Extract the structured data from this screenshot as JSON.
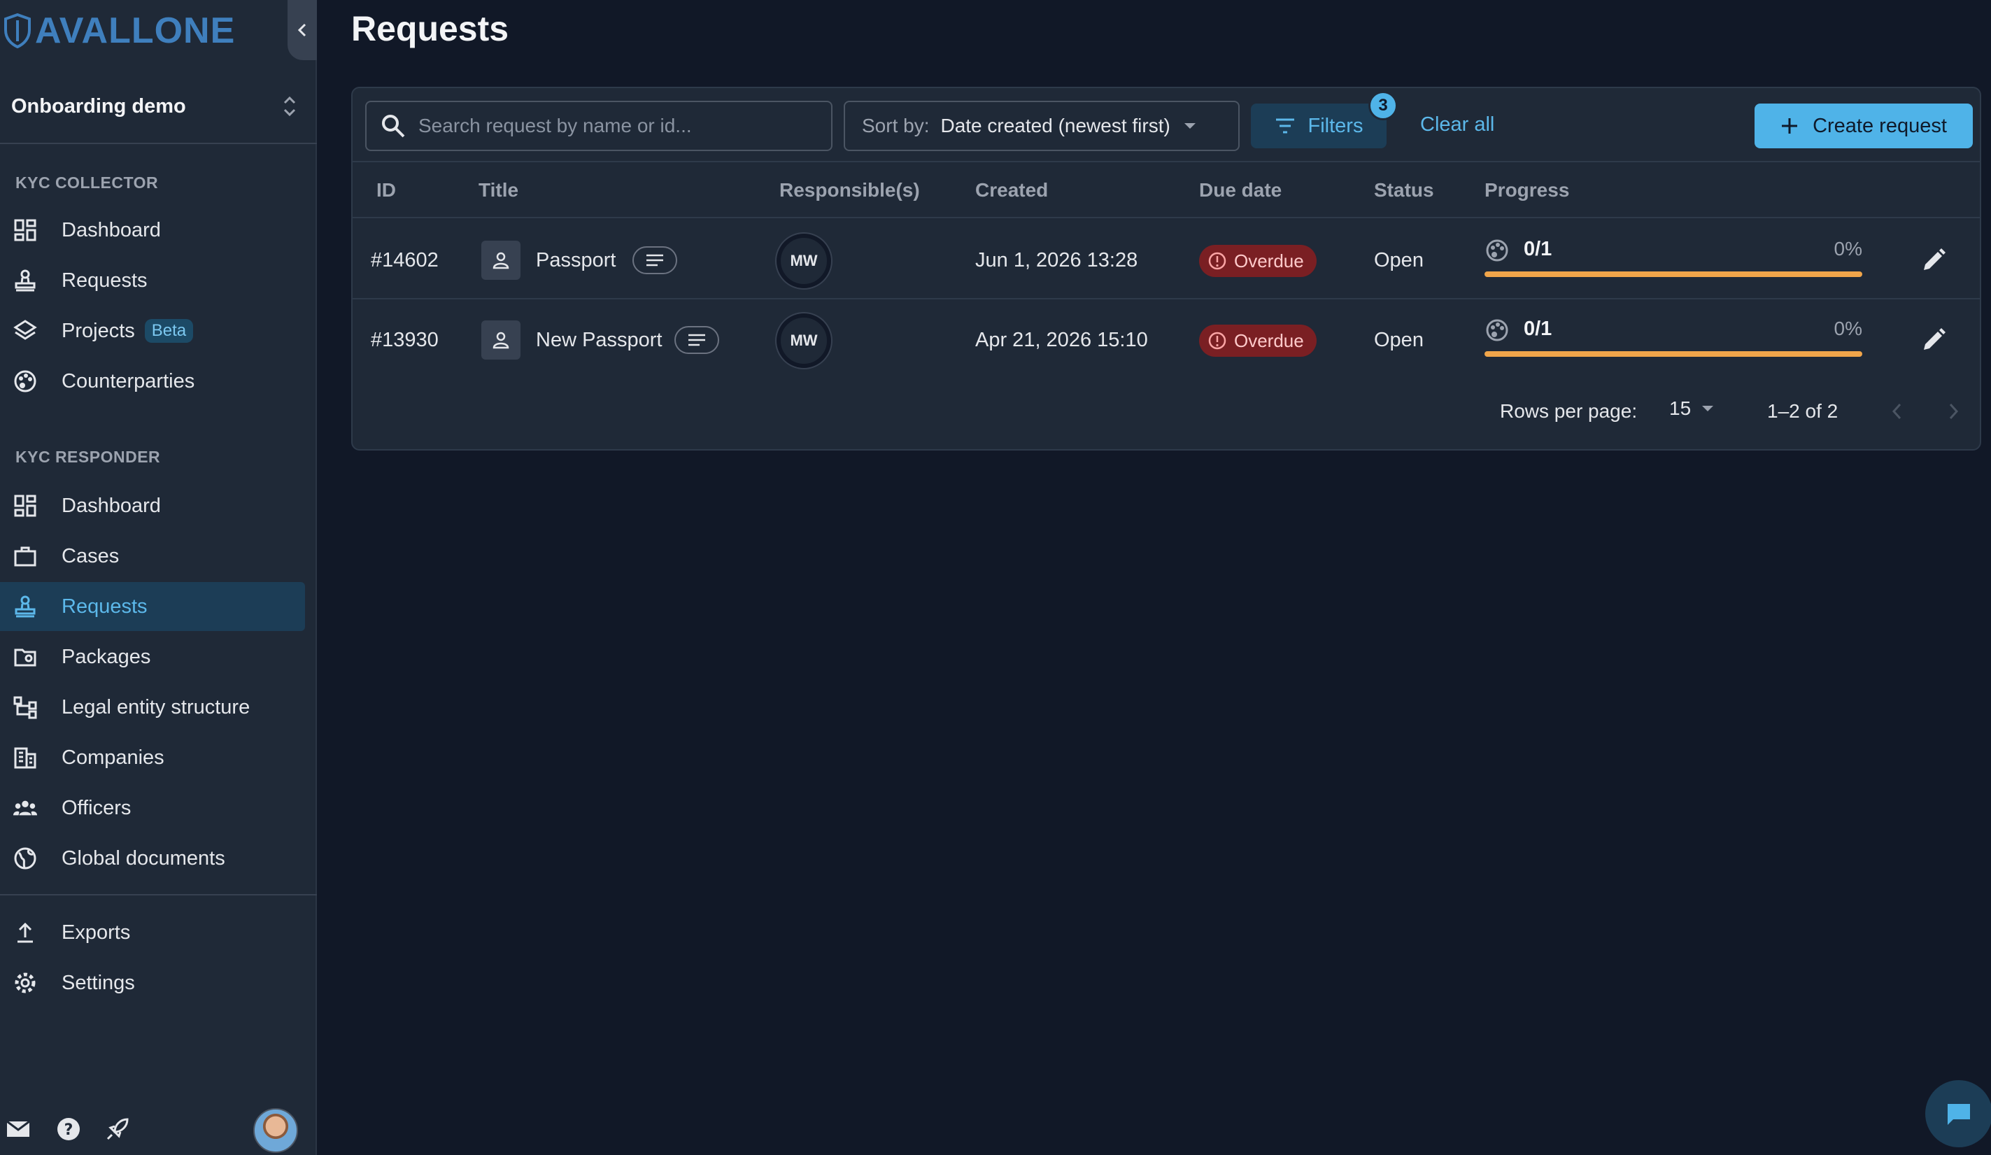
{
  "brand": {
    "logo_text": "AVALLONE",
    "accent": "#4fb3e8",
    "logo_color": "#3f7fbd"
  },
  "workspace": {
    "name": "Onboarding demo"
  },
  "sidebar": {
    "sections": [
      {
        "title": "KYC COLLECTOR",
        "items": [
          {
            "label": "Dashboard",
            "icon": "dashboard-icon"
          },
          {
            "label": "Requests",
            "icon": "stamp-icon"
          },
          {
            "label": "Projects",
            "icon": "layers-icon",
            "badge": "Beta"
          },
          {
            "label": "Counterparties",
            "icon": "palette-icon"
          }
        ]
      },
      {
        "title": "KYC RESPONDER",
        "items": [
          {
            "label": "Dashboard",
            "icon": "dashboard-icon"
          },
          {
            "label": "Cases",
            "icon": "briefcase-icon"
          },
          {
            "label": "Requests",
            "icon": "stamp-icon",
            "active": true
          },
          {
            "label": "Packages",
            "icon": "folder-icon"
          },
          {
            "label": "Legal entity structure",
            "icon": "hierarchy-icon"
          },
          {
            "label": "Companies",
            "icon": "building-icon"
          },
          {
            "label": "Officers",
            "icon": "people-icon"
          },
          {
            "label": "Global documents",
            "icon": "globe-icon"
          }
        ]
      }
    ],
    "bottom_items": [
      {
        "label": "Exports",
        "icon": "upload-icon"
      },
      {
        "label": "Settings",
        "icon": "gear-icon"
      }
    ],
    "footer_icons": [
      "mail-icon",
      "help-icon",
      "rocket-icon",
      "user-avatar"
    ]
  },
  "page": {
    "title": "Requests"
  },
  "toolbar": {
    "search_placeholder": "Search request by name or id...",
    "sort_label": "Sort by:",
    "sort_value": "Date created (newest first)",
    "filters_label": "Filters",
    "filters_count": "3",
    "clear_all": "Clear all",
    "create_label": "Create request"
  },
  "table": {
    "columns": [
      "ID",
      "Title",
      "Responsible(s)",
      "Created",
      "Due date",
      "Status",
      "Progress"
    ],
    "rows": [
      {
        "id": "#14602",
        "title": "Passport",
        "responsible": "MW",
        "created": "Jun 1, 2026 13:28",
        "due": "Overdue",
        "status": "Open",
        "progress_frac": "0/1",
        "progress_pct": "0%",
        "progress_value": 0
      },
      {
        "id": "#13930",
        "title": "New Passport",
        "responsible": "MW",
        "created": "Apr 21, 2026 15:10",
        "due": "Overdue",
        "status": "Open",
        "progress_frac": "0/1",
        "progress_pct": "0%",
        "progress_value": 0
      }
    ]
  },
  "pagination": {
    "rows_label": "Rows per page:",
    "rows_value": "15",
    "range": "1–2 of 2"
  }
}
